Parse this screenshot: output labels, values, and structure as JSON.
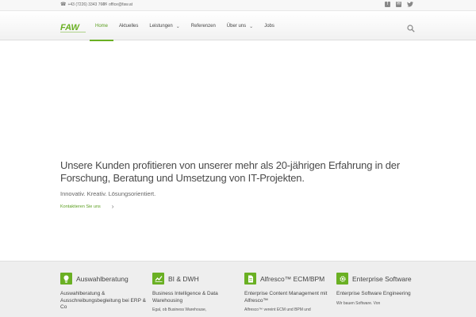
{
  "topbar": {
    "phone": "+43 (7226) 3343 766 - ",
    "email": "office@faw.at",
    "social": {
      "facebook": "f",
      "mail": "✉",
      "twitter": "🐦"
    }
  },
  "logo": {
    "text": "FAW",
    "tagline": "Consulting"
  },
  "nav": {
    "items": [
      {
        "label": "Home"
      },
      {
        "label": "Aktuelles"
      },
      {
        "label": "Leistungen",
        "chevron": "⌄"
      },
      {
        "label": "Referenzen"
      },
      {
        "label": "Über uns",
        "chevron": "⌄"
      },
      {
        "label": "Jobs"
      }
    ],
    "active_index": 0
  },
  "hero": {
    "title": "Unsere Kunden profitieren von unserer mehr als 20-jährigen Erfahrung in der Forschung, Beratung und Umsetzung von IT-Projekten.",
    "subtitle": "Innovativ. Kreativ. Lösungsorientiert.",
    "cta_label": "Kontaktieren Sie uns",
    "cta_arrow": "›"
  },
  "services": [
    {
      "title": "Auswahlberatung",
      "icon": "lightbulb-icon",
      "text": "Auswahlberatung & Ausschreibungsbegleitung bei ERP & Co",
      "small": ""
    },
    {
      "title": "BI & DWH",
      "icon": "chart-icon",
      "text": "Business Intelligence & Data Warehousing",
      "small": "Egal, ob Business Warehouse,"
    },
    {
      "title": "Alfresco™ ECM/BPM",
      "icon": "document-icon",
      "text": "Enterprise Content Management mit Alfresco™",
      "small": "Alfresco™ vereint ECM und BPM und"
    },
    {
      "title": "Enterprise Software",
      "icon": "gear-icon",
      "text": "Enterprise Software Engineering",
      "small": "Wir bauen Software. Von"
    }
  ],
  "colors": {
    "accent": "#6ab023",
    "text": "#444444"
  }
}
